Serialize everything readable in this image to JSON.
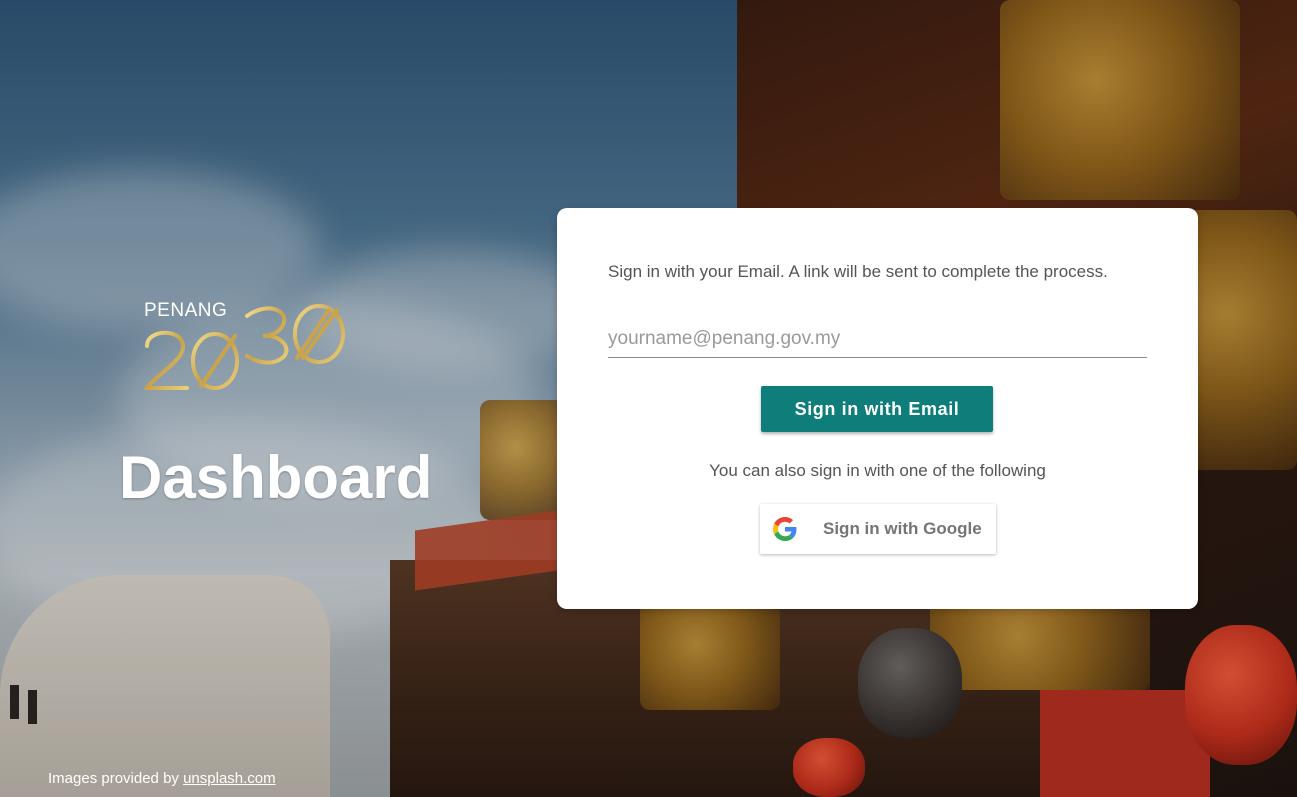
{
  "brand": {
    "logo_text_top": "PENANG",
    "logo_text_number": "2030",
    "logo_color": "#d4b25a"
  },
  "page_title": "Dashboard",
  "credit": {
    "prefix": "Images provided by ",
    "link_text": "unsplash.com"
  },
  "signin": {
    "instructions": "Sign in with your Email. A link will be sent to complete the process.",
    "email_placeholder": "yourname@penang.gov.my",
    "email_value": "",
    "email_button_label": "Sign in with Email",
    "alternative_text": "You can also sign in with one of the following",
    "google_button_label": "Sign in with Google",
    "google_icon": "google-g-icon"
  },
  "colors": {
    "accent": "#0f7e7b",
    "card_background": "#ffffff",
    "text_muted": "#555555"
  }
}
